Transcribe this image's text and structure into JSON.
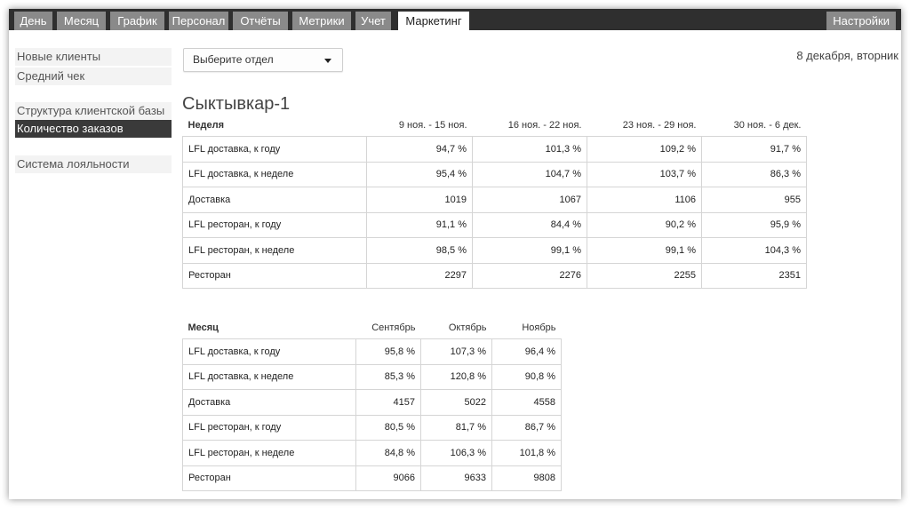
{
  "nav": {
    "tabs": [
      {
        "label": "День"
      },
      {
        "label": "Месяц"
      },
      {
        "label": "График"
      },
      {
        "label": "Персонал"
      },
      {
        "label": "Отчёты"
      },
      {
        "label": "Метрики"
      },
      {
        "label": "Учет"
      },
      {
        "label": "Маркетинг",
        "active": true
      }
    ],
    "settings_label": "Настройки"
  },
  "sidebar": {
    "items": [
      {
        "label": "Новые клиенты"
      },
      {
        "label": "Средний чек"
      },
      {
        "label": "Структура клиентской базы"
      },
      {
        "label": "Количество заказов",
        "active": true
      },
      {
        "label": "Система лояльности"
      }
    ]
  },
  "filter": {
    "department_placeholder": "Выберите отдел"
  },
  "date_label": "8 декабря, вторник",
  "location_title": "Сыктывкар-1",
  "weekly": {
    "header_label": "Неделя",
    "columns": [
      "9 ноя. - 15 ноя.",
      "16 ноя. - 22 ноя.",
      "23 ноя. - 29 ноя.",
      "30 ноя. - 6 дек."
    ],
    "rows": [
      {
        "label": "LFL доставка, к году",
        "values": [
          "94,7 %",
          "101,3 %",
          "109,2 %",
          "91,7 %"
        ]
      },
      {
        "label": "LFL доставка, к неделе",
        "values": [
          "95,4 %",
          "104,7 %",
          "103,7 %",
          "86,3 %"
        ]
      },
      {
        "label": "Доставка",
        "values": [
          "1019",
          "1067",
          "1106",
          "955"
        ]
      },
      {
        "label": "LFL ресторан, к году",
        "values": [
          "91,1 %",
          "84,4 %",
          "90,2 %",
          "95,9 %"
        ]
      },
      {
        "label": "LFL ресторан, к неделе",
        "values": [
          "98,5 %",
          "99,1 %",
          "99,1 %",
          "104,3 %"
        ]
      },
      {
        "label": "Ресторан",
        "values": [
          "2297",
          "2276",
          "2255",
          "2351"
        ]
      }
    ]
  },
  "monthly": {
    "header_label": "Месяц",
    "columns": [
      "Сентябрь",
      "Октябрь",
      "Ноябрь"
    ],
    "rows": [
      {
        "label": "LFL доставка, к году",
        "values": [
          "95,8 %",
          "107,3 %",
          "96,4 %"
        ]
      },
      {
        "label": "LFL доставка, к неделе",
        "values": [
          "85,3 %",
          "120,8 %",
          "90,8 %"
        ]
      },
      {
        "label": "Доставка",
        "values": [
          "4157",
          "5022",
          "4558"
        ]
      },
      {
        "label": "LFL ресторан, к году",
        "values": [
          "80,5 %",
          "81,7 %",
          "86,7 %"
        ]
      },
      {
        "label": "LFL ресторан, к неделе",
        "values": [
          "84,8 %",
          "106,3 %",
          "101,8 %"
        ]
      },
      {
        "label": "Ресторан",
        "values": [
          "9066",
          "9633",
          "9808"
        ]
      }
    ]
  }
}
